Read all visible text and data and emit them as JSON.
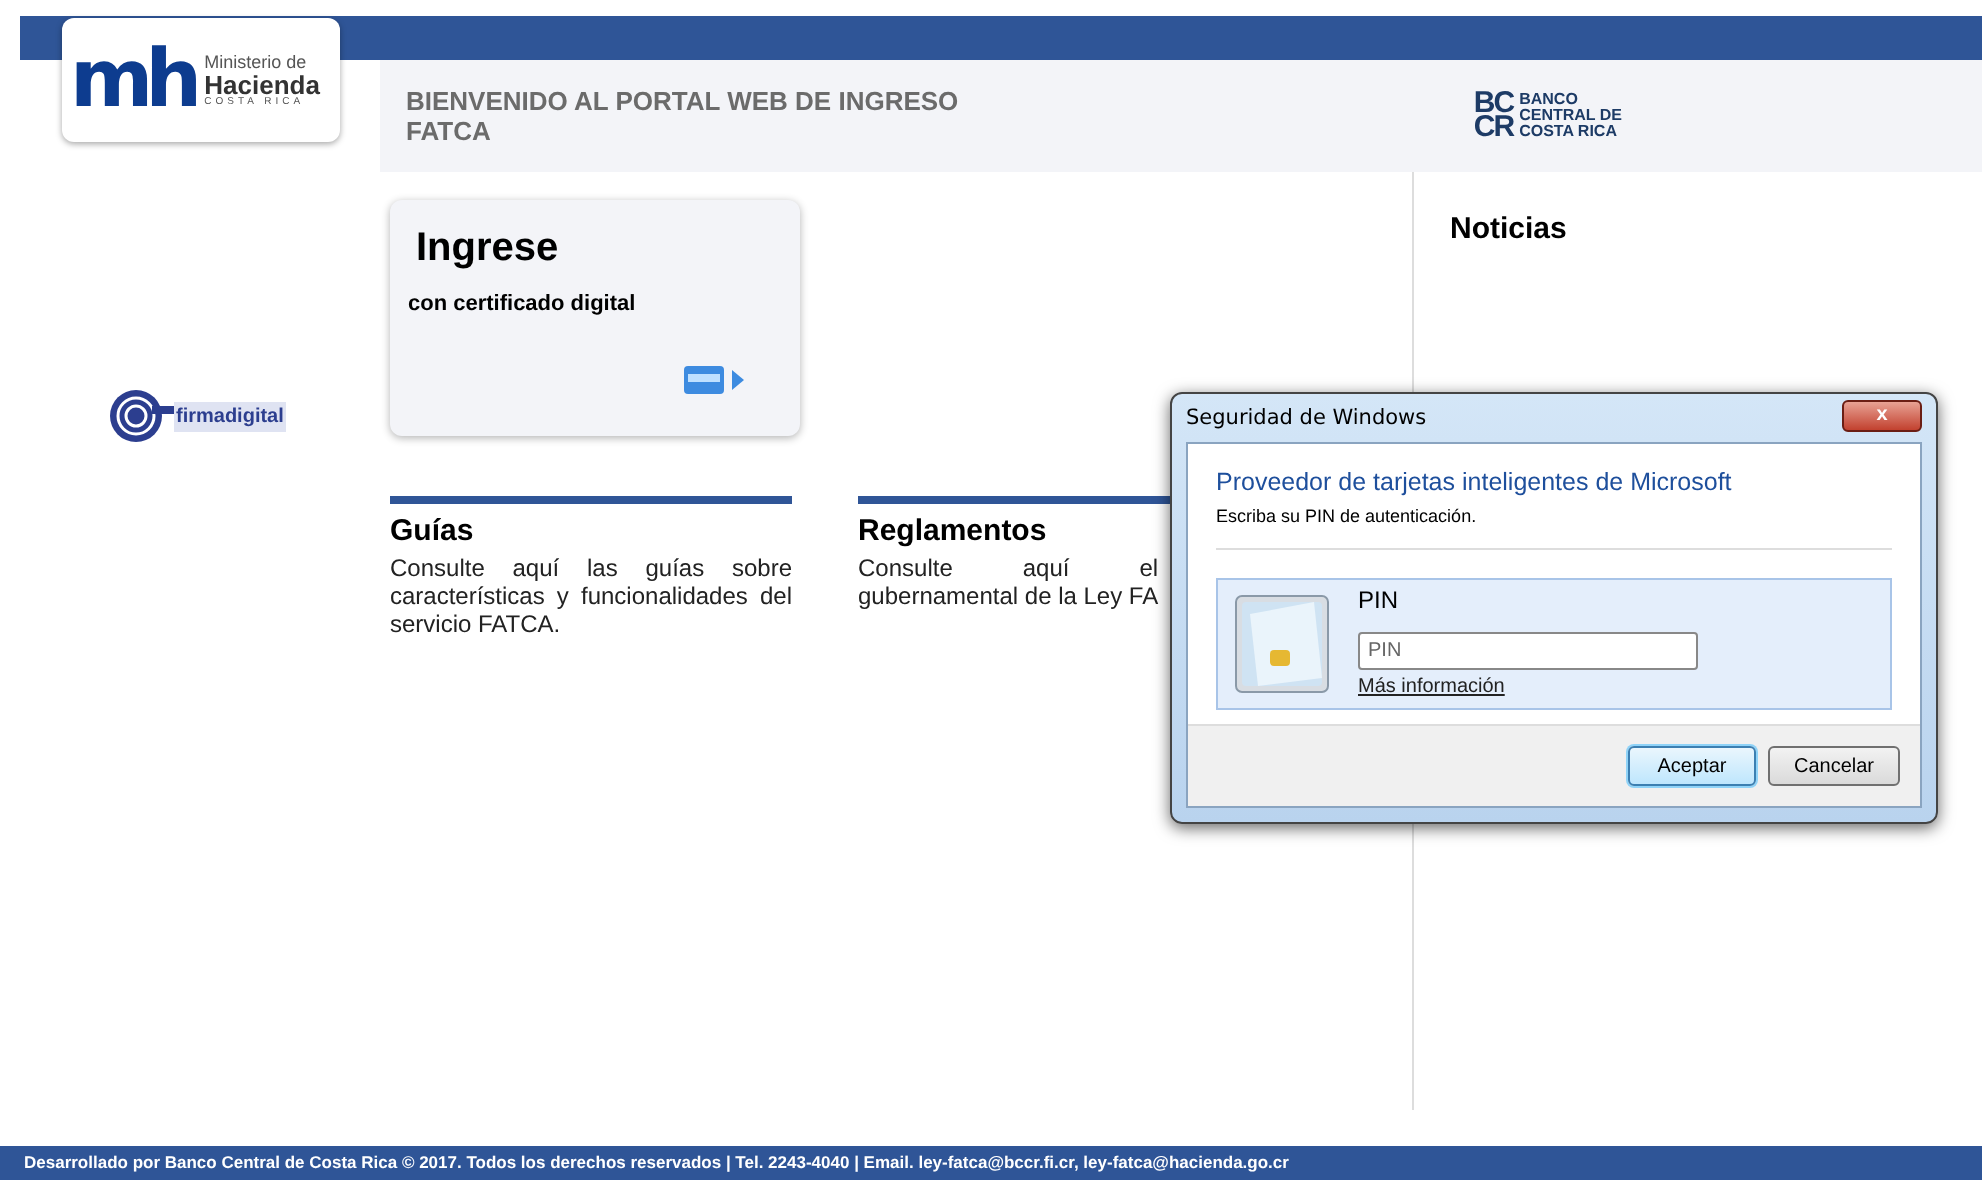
{
  "logo_mh": {
    "mark": "mh",
    "line1": "Ministerio de",
    "line2": "Hacienda",
    "line3": "COSTA RICA"
  },
  "header": {
    "title_lines": [
      "BIENVENIDO AL PORTAL WEB DE INGRESO",
      "FATCA"
    ]
  },
  "logo_bccr": {
    "mark_top": "BC",
    "mark_bottom": "CR",
    "lines": [
      "BANCO",
      "CENTRAL DE",
      "COSTA RICA"
    ]
  },
  "logo_firma": {
    "text": "firmadigital"
  },
  "login_card": {
    "title": "Ingrese",
    "subtitle": "con certificado digital"
  },
  "sections": [
    {
      "title": "Guías",
      "lines": [
        "Consulte aquí las guías sobre características y funcionalidades del servicio FATCA."
      ]
    },
    {
      "title": "Reglamentos",
      "lines": [
        "Consulte aquí el",
        "gubernamental de la Ley FA"
      ]
    }
  ],
  "news": {
    "title": "Noticias"
  },
  "dialog": {
    "title": "Seguridad de Windows",
    "close": "x",
    "heading": "Proveedor de tarjetas inteligentes de Microsoft",
    "subheading": "Escriba su PIN de autenticación.",
    "pin_label": "PIN",
    "pin_placeholder": "PIN",
    "link": "Más información",
    "buttons": [
      {
        "label": "Aceptar",
        "selected": true
      },
      {
        "label": "Cancelar",
        "selected": false
      }
    ]
  },
  "footer": {
    "text": "Desarrollado por Banco Central de Costa Rica © 2017. Todos los derechos reservados | Tel. 2243-4040 | Email. ley-fatca@bccr.fi.cr, ley-fatca@hacienda.go.cr"
  }
}
